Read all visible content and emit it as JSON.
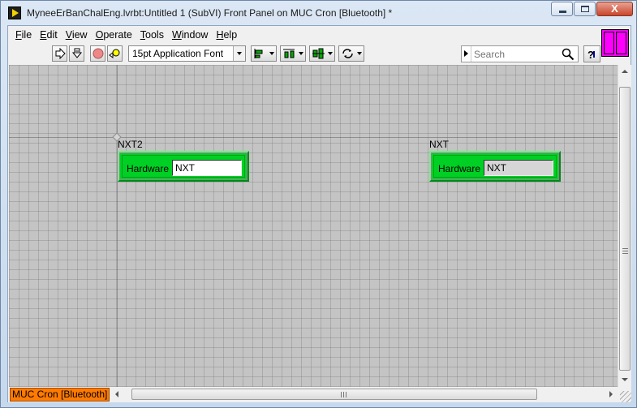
{
  "window": {
    "title": "MyneeErBanChalEng.lvrbt:Untitled 1 (SubVI) Front Panel on MUC Cron [Bluetooth] *",
    "close_glyph": "X"
  },
  "menu": {
    "items": [
      {
        "label": "File",
        "hotkey": "F",
        "rest": "ile"
      },
      {
        "label": "Edit",
        "hotkey": "E",
        "rest": "dit"
      },
      {
        "label": "View",
        "hotkey": "V",
        "rest": "iew"
      },
      {
        "label": "Operate",
        "hotkey": "O",
        "rest": "perate"
      },
      {
        "label": "Tools",
        "hotkey": "T",
        "rest": "ools"
      },
      {
        "label": "Window",
        "hotkey": "W",
        "rest": "indow"
      },
      {
        "label": "Help",
        "hotkey": "H",
        "rest": "elp"
      }
    ]
  },
  "toolbar": {
    "font_select_value": "15pt Application Font",
    "search_placeholder": "Search",
    "buttons": [
      "run-arrow",
      "run-continuously",
      "abort",
      "pause",
      "align",
      "distribute",
      "resize",
      "reorder"
    ]
  },
  "panel": {
    "controls": [
      {
        "label": "NXT2",
        "field_label": "Hardware",
        "value": "NXT",
        "kind": "control"
      },
      {
        "label": "NXT",
        "field_label": "Hardware",
        "value": "NXT",
        "kind": "indicator"
      }
    ],
    "colors": {
      "cluster_green": "#00d024",
      "grid_bg": "#c4c4c4",
      "target_orange": "#ff7a00",
      "vi_icon_magenta": "#ff00ff"
    }
  },
  "status": {
    "target_label": "MUC Cron [Bluetooth]"
  }
}
